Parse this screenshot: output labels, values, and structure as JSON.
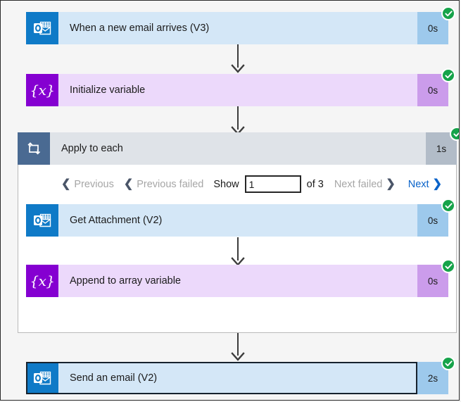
{
  "flow": {
    "background_color": "#f5f5f5",
    "steps": [
      {
        "name": "trigger-email",
        "title": "When a new email arrives (V3)",
        "duration": "0s",
        "status": "succeeded",
        "icon": "outlook-icon",
        "theme": "blue",
        "selected": false
      },
      {
        "name": "initialize-variable",
        "title": "Initialize variable",
        "duration": "0s",
        "status": "succeeded",
        "icon": "variable-icon",
        "theme": "purple",
        "selected": false
      },
      {
        "name": "apply-to-each",
        "title": "Apply to each",
        "duration": "1s",
        "status": "succeeded",
        "icon": "loop-icon",
        "theme": "slate",
        "selected": false
      },
      {
        "name": "get-attachment",
        "title": "Get Attachment (V2)",
        "duration": "0s",
        "status": "succeeded",
        "icon": "outlook-icon",
        "theme": "blue",
        "selected": false
      },
      {
        "name": "append-to-array-variable",
        "title": "Append to array variable",
        "duration": "0s",
        "status": "succeeded",
        "icon": "variable-icon",
        "theme": "purple",
        "selected": false
      },
      {
        "name": "send-an-email",
        "title": "Send an email (V2)",
        "duration": "2s",
        "status": "succeeded",
        "icon": "outlook-icon",
        "theme": "blue",
        "selected": true
      }
    ]
  },
  "pagination": {
    "previous_label": "Previous",
    "previous_failed_label": "Previous failed",
    "show_label": "Show",
    "current_page": "1",
    "of_label": "of 3",
    "total_pages": 3,
    "next_failed_label": "Next failed",
    "next_label": "Next",
    "chevron_left": "❮",
    "chevron_right": "❯",
    "previous_enabled": false,
    "previous_failed_enabled": false,
    "next_failed_enabled": false,
    "next_enabled": true
  },
  "colors": {
    "blue_icon": "#0f7ac7",
    "blue_body": "#d4e7f7",
    "blue_duration": "#9dc9ec",
    "purple_icon": "#8500d1",
    "purple_body": "#ecd9fb",
    "purple_duration": "#cb9ceb",
    "slate_icon": "#4a6a92",
    "slate_body": "#dfe3e8",
    "slate_duration": "#b2bcc8",
    "success_green": "#16a34a",
    "link_blue": "#0a63c9",
    "selection_outline": "#16222e"
  }
}
